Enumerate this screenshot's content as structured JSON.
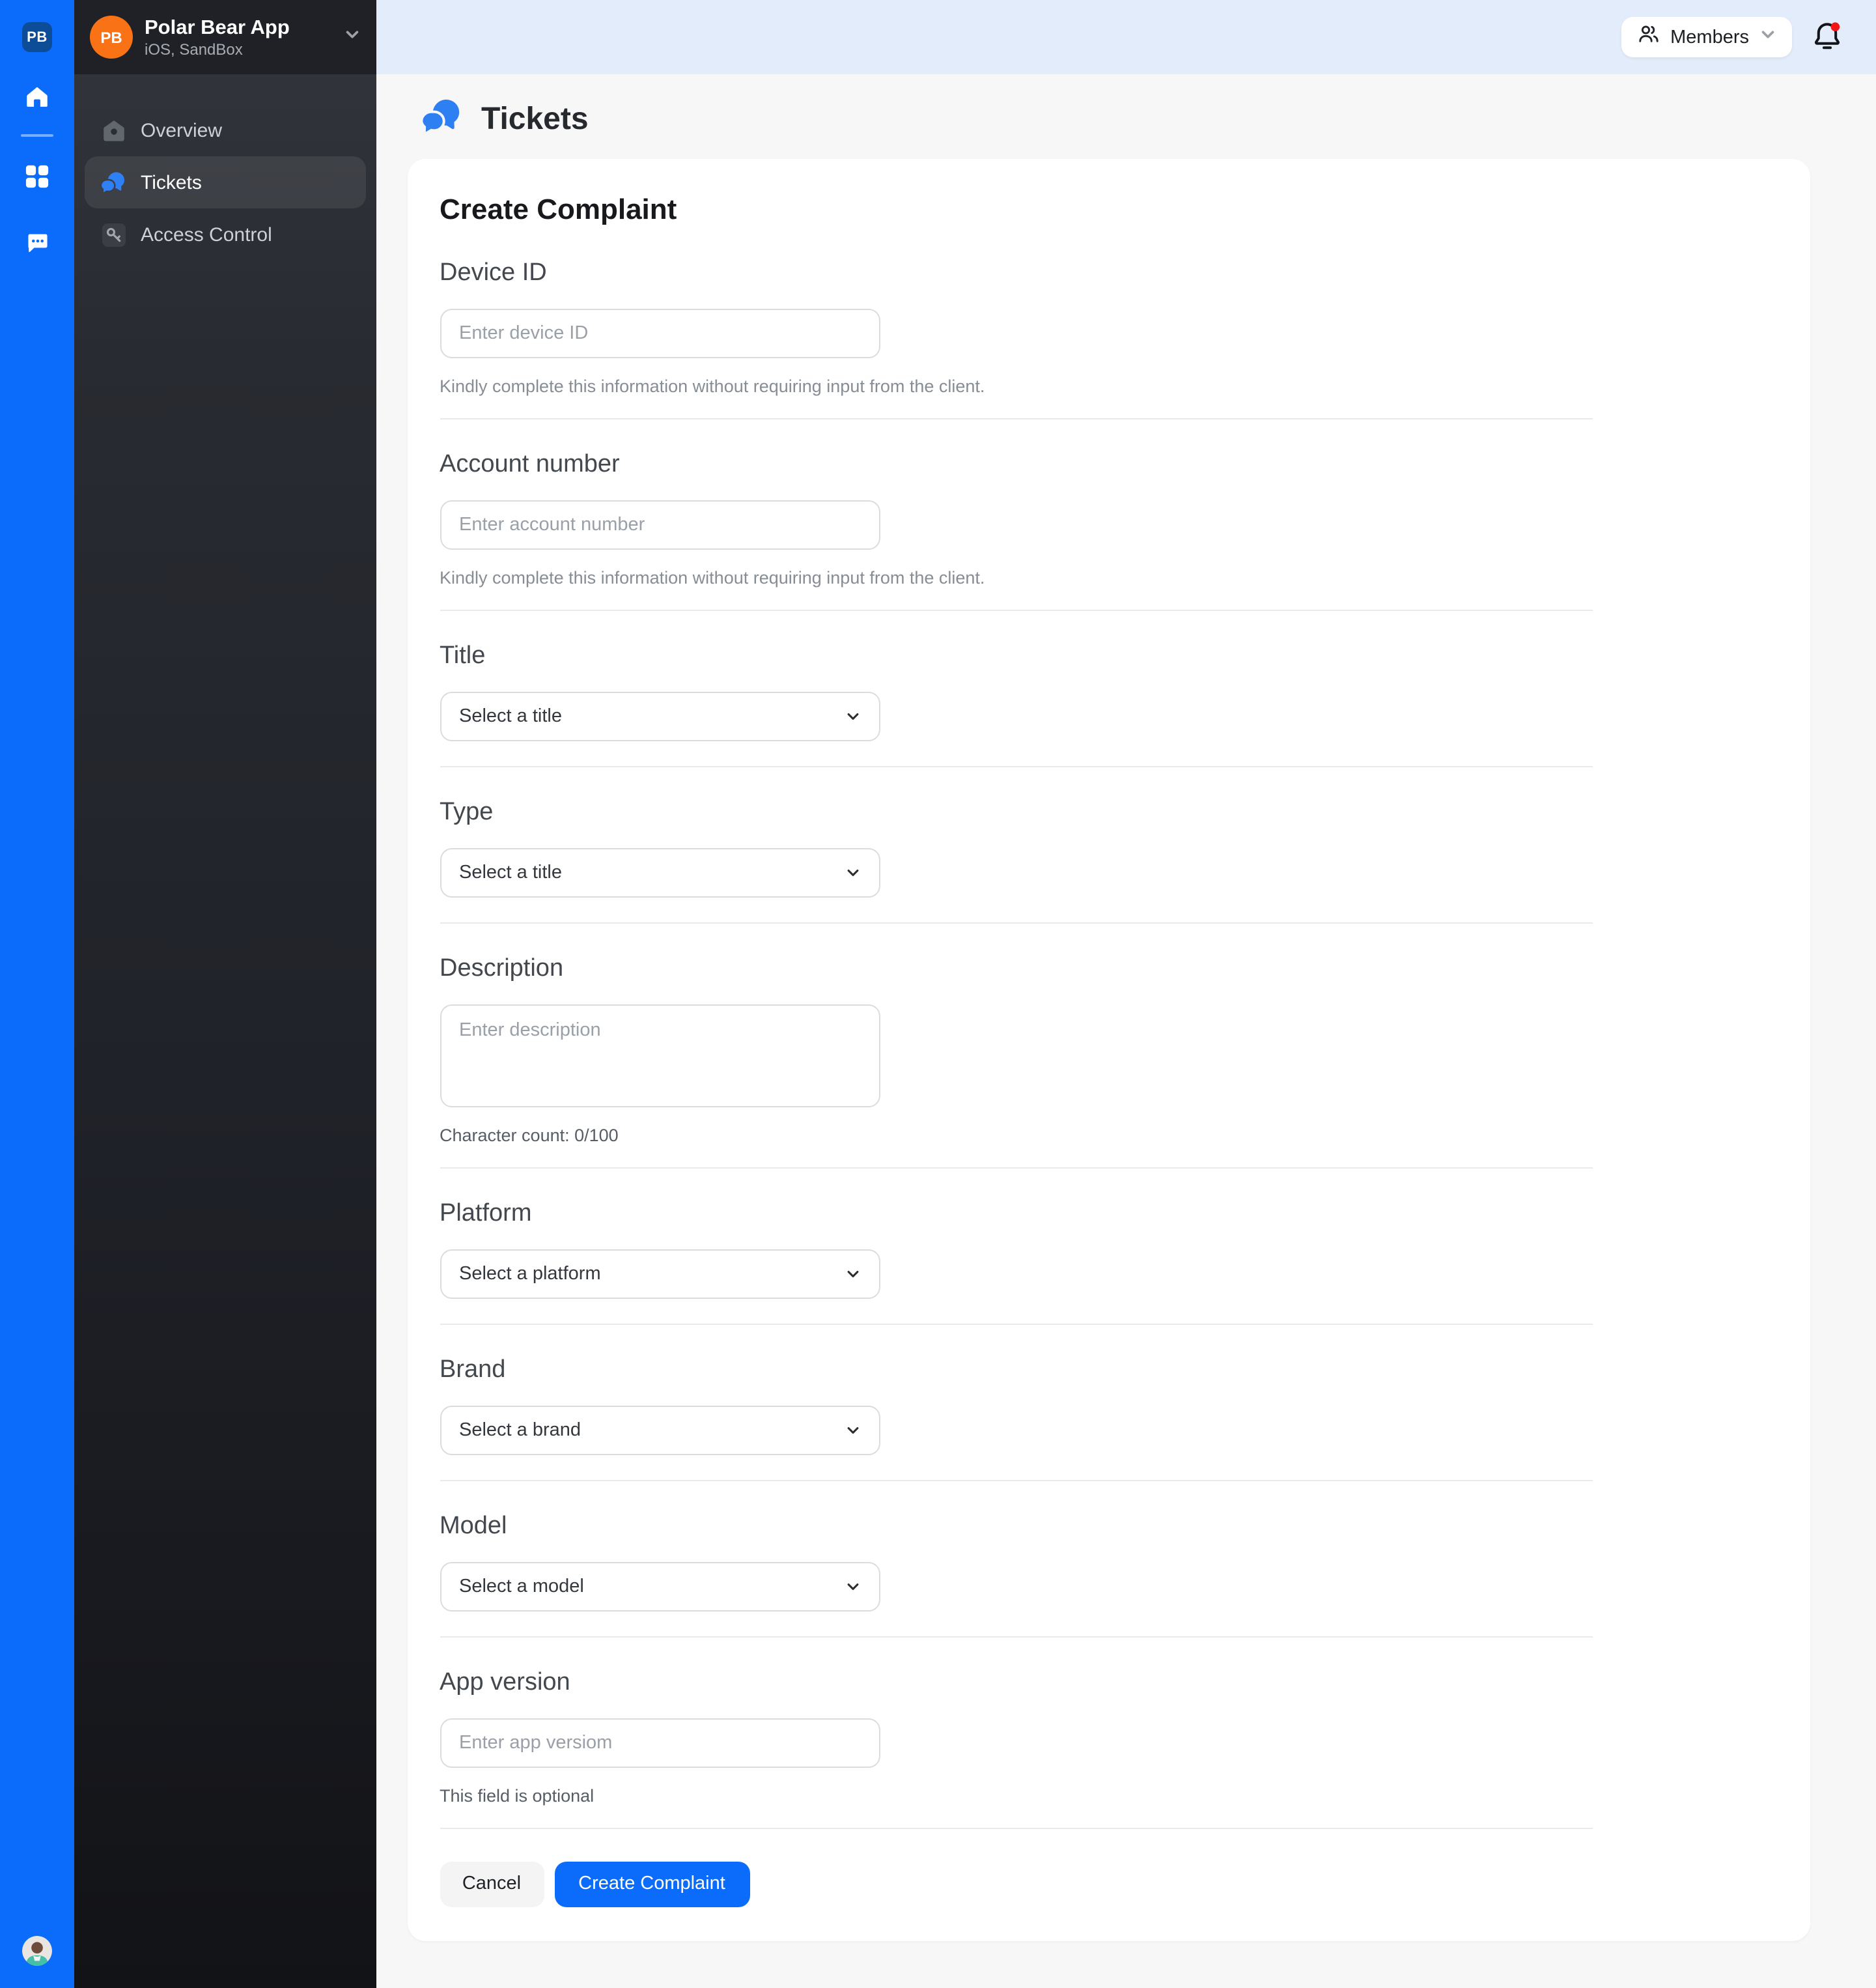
{
  "colors": {
    "brand_blue": "#0B6BFB",
    "rail_logo_bg": "#0D4C96",
    "accent_orange": "#F97316",
    "notification_red": "#F41414",
    "topstrip_blue": "#E3ECFA",
    "sidebar_dark": "#1F2126"
  },
  "rail": {
    "logo_text": "PB"
  },
  "sidebar": {
    "app_initials": "PB",
    "app_name": "Polar Bear App",
    "app_subtitle": "iOS, SandBox",
    "items": [
      {
        "label": "Overview"
      },
      {
        "label": "Tickets"
      },
      {
        "label": "Access Control"
      }
    ]
  },
  "topbar": {
    "members_label": "Members"
  },
  "page": {
    "title": "Tickets"
  },
  "form": {
    "heading": "Create Complaint",
    "fields": [
      {
        "label": "Device ID",
        "placeholder": "Enter device ID",
        "helper": "Kindly complete this information without requiring input from the client."
      },
      {
        "label": "Account number",
        "placeholder": "Enter account number",
        "helper": "Kindly complete this information without requiring input from the client."
      },
      {
        "label": "Title",
        "placeholder": "Select a title"
      },
      {
        "label": "Type",
        "placeholder": "Select a title"
      },
      {
        "label": "Description",
        "placeholder": "Enter description",
        "helper": "Character count: 0/100"
      },
      {
        "label": "Platform",
        "placeholder": "Select a platform"
      },
      {
        "label": "Brand",
        "placeholder": "Select a brand"
      },
      {
        "label": "Model",
        "placeholder": "Select a model"
      },
      {
        "label": "App version",
        "placeholder": "Enter app versiom",
        "helper": "This field is optional"
      }
    ],
    "cancel_label": "Cancel",
    "submit_label": "Create Complaint"
  }
}
